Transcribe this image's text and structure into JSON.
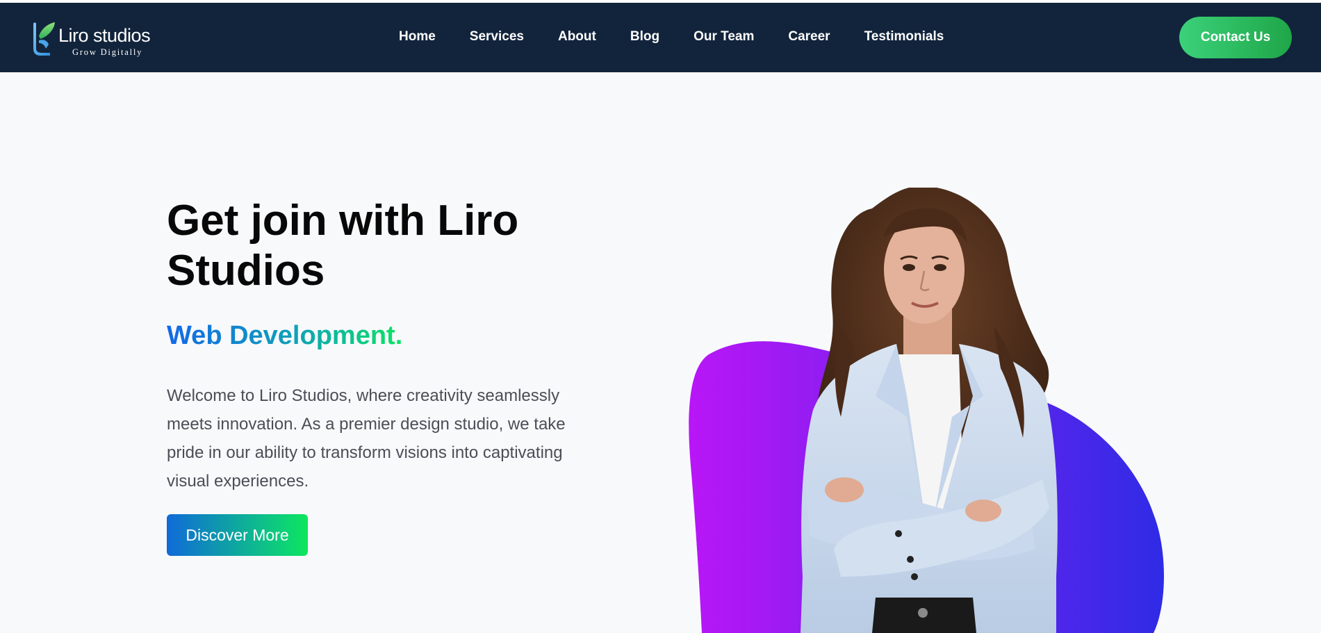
{
  "brand": {
    "name": "Liro studios",
    "tagline": "Grow Digitally"
  },
  "nav": {
    "items": [
      {
        "label": "Home"
      },
      {
        "label": "Services"
      },
      {
        "label": "About"
      },
      {
        "label": "Blog"
      },
      {
        "label": "Our Team"
      },
      {
        "label": "Career"
      },
      {
        "label": "Testimonials"
      }
    ],
    "contact_label": "Contact Us"
  },
  "hero": {
    "title": "Get join with Liro Studios",
    "subtitle": "Web Development.",
    "body": "Welcome to Liro Studios, where creativity seamlessly meets innovation. As a premier design studio, we take pride in our ability to transform visions into captivating visual experiences.",
    "cta_label": "Discover More"
  },
  "colors": {
    "navbar_bg": "#12243b",
    "contact_green": "#2fbf64",
    "blob_magenta": "#b316f5",
    "blob_blue": "#2f2ae8",
    "subtitle_gradient": [
      "#1368e8",
      "#0be463"
    ]
  }
}
